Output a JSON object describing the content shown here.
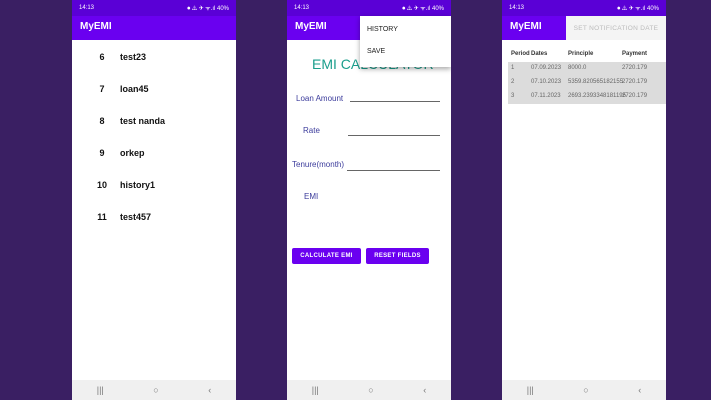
{
  "screens": [
    {
      "status_time": "14:13",
      "status_right": "⏺ ⚠ ✈ ᯤ.ıl 40%",
      "app_title": "MyEMI",
      "entries": [
        {
          "num": "6",
          "name": "test23"
        },
        {
          "num": "7",
          "name": "loan45"
        },
        {
          "num": "8",
          "name": "test nanda"
        },
        {
          "num": "9",
          "name": "orkep"
        },
        {
          "num": "10",
          "name": "history1"
        },
        {
          "num": "11",
          "name": "test457"
        }
      ]
    },
    {
      "status_time": "14:13",
      "status_right": "⏺ ⚠ ✈ ᯤ.ıl 40%",
      "app_title": "MyEMI",
      "calc_title": "EMI CALCULATOR",
      "loan_label": "Loan Amount",
      "rate_label": "Rate",
      "tenure_label": "Tenure(month)",
      "emi_label": "EMI",
      "calculate_label": "CALCULATE EMI",
      "reset_label": "RESET FIELDS",
      "menu": [
        "HISTORY",
        "SAVE"
      ]
    },
    {
      "status_time": "14:13",
      "status_right": "⏺ ⚠ ✈ ᯤ.ıl 40%",
      "app_title": "MyEMI",
      "notif_label": "SET NOTIFICATION DATE",
      "headers": [
        "Period",
        "Dates",
        "Principle",
        "Payment"
      ],
      "rows": [
        [
          "1",
          "07.09.2023",
          "8000.0",
          "2720.179"
        ],
        [
          "2",
          "07.10.2023",
          "5359.820565182155",
          "2720.179"
        ],
        [
          "3",
          "07.11.2023",
          "2693.2393348181195",
          "2720.179"
        ]
      ]
    }
  ],
  "nav": {
    "recents": "|||",
    "home": "○",
    "back": "‹"
  },
  "colors": {
    "appbar": "#6a00f0",
    "background": "#3a1f63",
    "accent": "#1a9e8c"
  }
}
